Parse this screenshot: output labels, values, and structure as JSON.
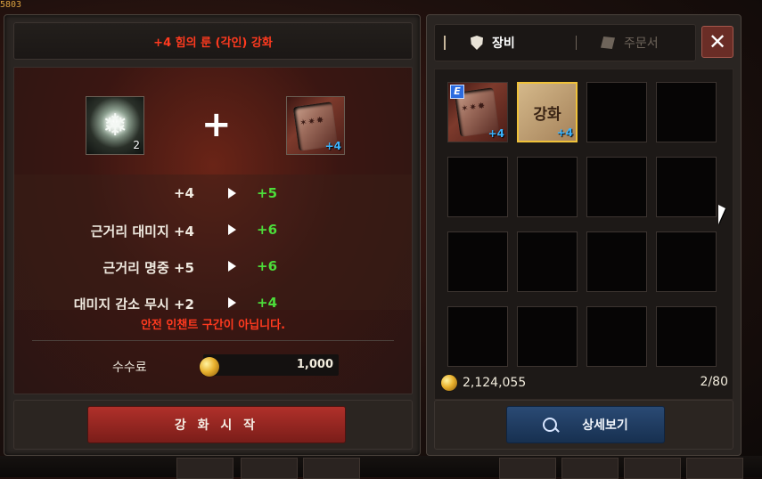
{
  "top_counter": "5803",
  "enhance": {
    "title": "+4 힘의 룬 (각인) 강화",
    "material_count": "2",
    "target_level": "+4",
    "plus_symbol": "+",
    "stats": [
      {
        "label": "+4",
        "new": "+5"
      },
      {
        "label": "근거리 대미지 +4",
        "new": "+6"
      },
      {
        "label": "근거리 명중 +5",
        "new": "+6"
      },
      {
        "label": "대미지 감소 무시 +2",
        "new": "+4"
      }
    ],
    "warning": "안전 인챈트 구간이 아닙니다.",
    "fee_label": "수수료",
    "fee_value": "1,000",
    "start_button": "강 화 시 작"
  },
  "inventory": {
    "tabs": [
      {
        "label": "장비",
        "icon": "shield-icon",
        "active": true
      },
      {
        "label": "주문서",
        "icon": "scroll-icon",
        "active": false
      }
    ],
    "close_symbol": "✕",
    "items": [
      {
        "badge": "E",
        "level": "+4",
        "icon": "rune-book-icon"
      },
      {
        "text": "강화",
        "level": "+4",
        "icon": "enchant-scroll-icon",
        "selected": true
      }
    ],
    "gold": "2,124,055",
    "slot_count": "2/80",
    "detail_button": "상세보기"
  },
  "colors": {
    "accent_red": "#ff3a1f",
    "stat_green": "#4cdc3a",
    "level_blue": "#3ab4ff"
  }
}
